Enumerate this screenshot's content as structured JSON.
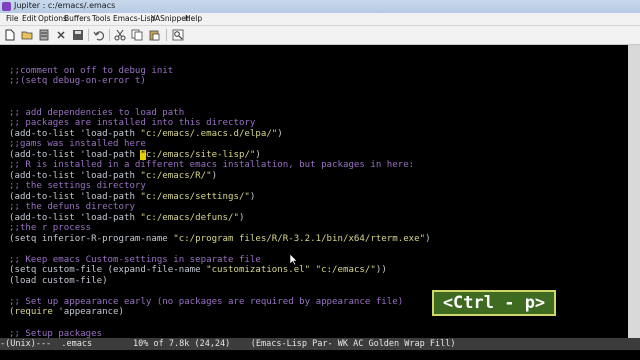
{
  "window": {
    "title": "Jupiter : c:/emacs/.emacs"
  },
  "menu": [
    "File",
    "Edit",
    "Options",
    "Buffers",
    "Tools",
    "Emacs-Lisp",
    "YASnippet",
    "Help"
  ],
  "toolbar_icons": [
    "new-file-icon",
    "open-folder-icon",
    "dired-icon",
    "close-buffer-icon",
    "save-icon",
    "undo-icon",
    "cut-icon",
    "copy-icon",
    "paste-icon",
    "search-icon"
  ],
  "code": {
    "l1": ";;comment on off to debug init",
    "l2": ";;(setq debug-on-error t)",
    "l3": ";; add dependencies to load path",
    "l4": ";; packages are installed into this directory",
    "l5a": "(add-to-list 'load-path ",
    "l5b": "\"c:/emacs/.emacs.d/elpa/\"",
    "l5c": ")",
    "l6": ";;gams was installed here",
    "l7a": "(add-to-list 'load-path ",
    "l7cur": "\"",
    "l7b": "c:/emacs/site-lisp/\"",
    "l7c": ")",
    "l8": ";; R is installed in a different emacs installation, but packages in here:",
    "l9a": "(add-to-list 'load-path ",
    "l9b": "\"c:/emacs/R/\"",
    "l9c": ")",
    "l10": ";; the settings directory",
    "l11a": "(add-to-list 'load-path ",
    "l11b": "\"c:/emacs/settings/\"",
    "l11c": ")",
    "l12": ";; the defuns directory",
    "l13a": "(add-to-list 'load-path ",
    "l13b": "\"c:/emacs/defuns/\"",
    "l13c": ")",
    "l14": ";;the r process",
    "l15a": "(setq inferior-R-program-name ",
    "l15b": "\"c:/program files/R/R-3.2.1/bin/x64/rterm.exe\"",
    "l15c": ")",
    "l16": ";; Keep emacs Custom-settings in separate file",
    "l17a": "(setq custom-file (expand-file-name ",
    "l17b": "\"customizations.el\"",
    "l17c": " ",
    "l17d": "\"c:/emacs/\"",
    "l17e": "))",
    "l18": "(load custom-file)",
    "l19": ";; Set up appearance early (no packages are required by appearance file)",
    "l20a": "(",
    "l20b": "require",
    "l20c": " 'appearance)",
    "l21": ";; Setup packages"
  },
  "modeline": "-(Unix)---  .emacs        10% of 7.8k (24,24)    (Emacs-Lisp Par- WK AC Golden Wrap Fill)",
  "keycast": "<Ctrl - p>",
  "colors": {
    "comment": "#9a70c4",
    "string": "#d8d68a",
    "cursor": "#e8d000",
    "keycast_bg": "#3e6b1f",
    "keycast_border": "#cfd66a"
  }
}
